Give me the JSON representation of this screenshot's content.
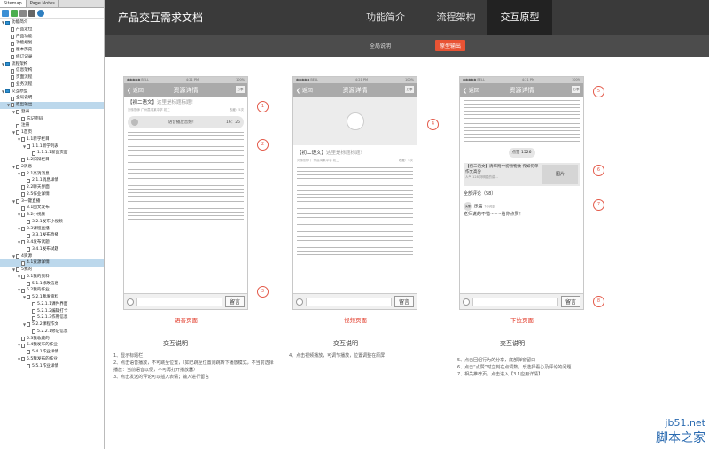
{
  "sidebar": {
    "tabs": [
      "Sitemap",
      "Page Notes"
    ],
    "items": [
      {
        "label": "功能简介",
        "level": 0,
        "folder": true,
        "toggle": "▼"
      },
      {
        "label": "产品定位",
        "level": 1
      },
      {
        "label": "产品功能",
        "level": 1
      },
      {
        "label": "功能规划",
        "level": 1
      },
      {
        "label": "版本历史",
        "level": 1
      },
      {
        "label": "修订记录",
        "level": 1
      },
      {
        "label": "流程架构",
        "level": 0,
        "folder": true,
        "toggle": "▼"
      },
      {
        "label": "信息架构",
        "level": 1
      },
      {
        "label": "页面流程",
        "level": 1
      },
      {
        "label": "业务流程",
        "level": 1
      },
      {
        "label": "交互原型",
        "level": 0,
        "folder": true,
        "toggle": "▼"
      },
      {
        "label": "全局说明",
        "level": 1
      },
      {
        "label": "原型输出",
        "level": 1,
        "selected": true,
        "toggle": "▼"
      },
      {
        "label": "登录",
        "level": 2,
        "toggle": "▼"
      },
      {
        "label": "忘记密码",
        "level": 3
      },
      {
        "label": "注册",
        "level": 2
      },
      {
        "label": "1首页",
        "level": 2,
        "toggle": "▼"
      },
      {
        "label": "1.1新学栏目",
        "level": 3,
        "toggle": "▼"
      },
      {
        "label": "1.1.1新学列表",
        "level": 4,
        "toggle": "▼"
      },
      {
        "label": "1.1.1.1新品页面",
        "level": 5
      },
      {
        "label": "1.2旧辩栏目",
        "level": 3
      },
      {
        "label": "2消息",
        "level": 2,
        "toggle": "▼"
      },
      {
        "label": "2.1高消消息",
        "level": 3,
        "toggle": "▼"
      },
      {
        "label": "2.1.1消息详情",
        "level": 4
      },
      {
        "label": "2.2聊天界面",
        "level": 3
      },
      {
        "label": "2.5作业详情",
        "level": 3
      },
      {
        "label": "3一键直播",
        "level": 2,
        "toggle": "▼"
      },
      {
        "label": "3.1图文发布",
        "level": 3
      },
      {
        "label": "3.2小视频",
        "level": 3,
        "toggle": "▼"
      },
      {
        "label": "3.2.1发布小视频",
        "level": 4
      },
      {
        "label": "3.3课程直播",
        "level": 3,
        "toggle": "▼"
      },
      {
        "label": "3.3.1发布直播",
        "level": 4
      },
      {
        "label": "3.4发布试题",
        "level": 3,
        "toggle": "▼"
      },
      {
        "label": "3.4.1发布试题",
        "level": 4
      },
      {
        "label": "4资源",
        "level": 2,
        "toggle": "▼"
      },
      {
        "label": "4.1资源详情",
        "level": 3,
        "selected": true
      },
      {
        "label": "5我的",
        "level": 2,
        "toggle": "▼"
      },
      {
        "label": "5.1我的资料",
        "level": 3,
        "toggle": "▼"
      },
      {
        "label": "5.1.1修改信息",
        "level": 4
      },
      {
        "label": "5.2我的作业",
        "level": 3,
        "toggle": "▼"
      },
      {
        "label": "5.2.1我发资料",
        "level": 4,
        "toggle": "▼"
      },
      {
        "label": "5.2.1.1课件界面",
        "level": 5
      },
      {
        "label": "5.2.1.2编辑打卡",
        "level": 5
      },
      {
        "label": "5.2.1.3作用信息",
        "level": 5
      },
      {
        "label": "5.2.2课程作文",
        "level": 4,
        "toggle": "▼"
      },
      {
        "label": "5.2.2.1修证信息",
        "level": 5
      },
      {
        "label": "5.3我收藏的",
        "level": 3
      },
      {
        "label": "5.4我发布的作业",
        "level": 3,
        "toggle": "▼"
      },
      {
        "label": "5.4.1作业详情",
        "level": 4
      },
      {
        "label": "5.5我发布的作业",
        "level": 3,
        "toggle": "▼"
      },
      {
        "label": "5.5.1作业详情",
        "level": 4
      }
    ]
  },
  "header": {
    "title": "产品交互需求文档",
    "nav": [
      "功能简介",
      "流程架构",
      "交互原型"
    ],
    "subnav": [
      "全局说明",
      "原型输出"
    ]
  },
  "phones": {
    "status_left": "●●●●● BELL",
    "status_time": "4:21 PM",
    "status_right": "100%",
    "back": "❮ 返回",
    "title": "资源详情",
    "share": "分享",
    "headline_tag": "【初二语文】",
    "headline_text": "这里是标题标题！",
    "meta_left": "刘传勤师  广州荔湾某中学  初二",
    "meta_right": "收藏：5次",
    "audio_label": "语音播放音频！",
    "audio_time": "16：25",
    "send": "留言",
    "like": "点赞 1526",
    "rec_title": "【初二语文】清华附中初物物数 作如何单作文高分",
    "rec_meta": "人气 128   刘明星的讲...",
    "rec_img": "图片",
    "comments": "全部评论（58）",
    "commenter": "乐雪",
    "comment_time": "7小时前",
    "comment_text": "老师说的不错~~~给你点赞！",
    "avatar": "头像"
  },
  "captions": [
    "语音页面",
    "视频页面",
    "下拉页面"
  ],
  "section_title": "交互说明",
  "notes": {
    "left": [
      "1、显示标题栏；",
      "2、点击语音播放，不可跳至位置，（如已跳至位置则跳转下播放模式，不当前选择播放：当前语音以便，不可再打开播放器）",
      "3、点击发送的评论可以插入表情；输入进行留言"
    ],
    "mid": [
      "4、点击视频播放，可调节播放，位置调整在原屏："
    ],
    "right": [
      "5、点击回组行为的分享，底部弹窗留口",
      "6、点击“点赞”时立刻在点赞数，乐选择看心及评论的问题",
      "7、相关推荐页，点击进入【3.1应用详情】"
    ]
  },
  "circles": [
    "1",
    "2",
    "3",
    "4",
    "5",
    "6",
    "7",
    "8"
  ],
  "watermark": {
    "site": "jb51.net",
    "name": "脚本之家"
  },
  "colors": {
    "accent": "#e85334",
    "header": "#3a3a3a",
    "subheader": "#4c4c4c",
    "caption": "#e23b2a"
  }
}
